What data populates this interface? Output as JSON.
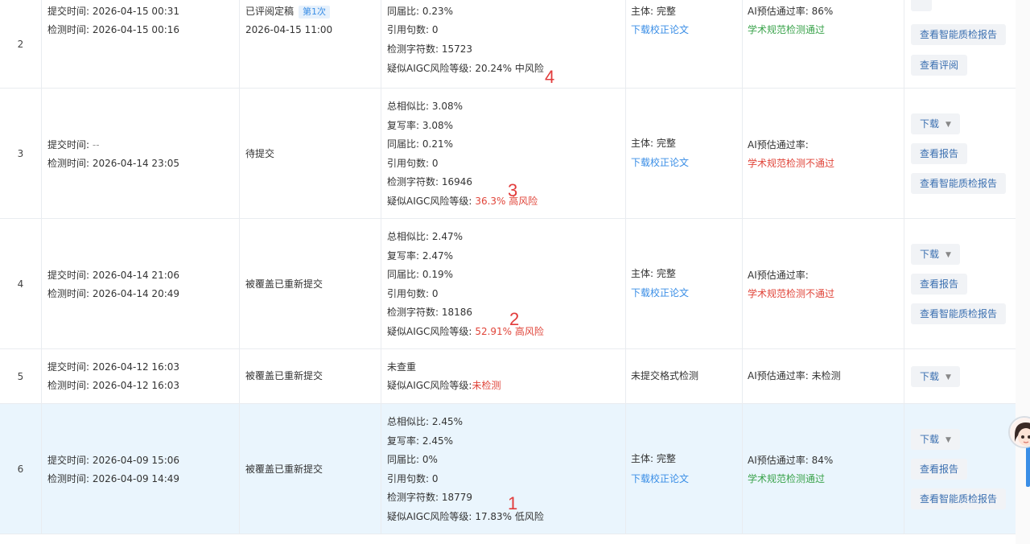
{
  "labels": {
    "submit_time": "提交时间:",
    "check_time": "检测时间:",
    "total_sim": "总相似比:",
    "rewrite_rate": "复写率:",
    "same_sim": "同届比:",
    "quote_count": "引用句数:",
    "char_count": "检测字符数:",
    "aigc_level": "疑似AIGC风险等级:",
    "subject": "主体:",
    "ai_pass": "AI预估通过率:"
  },
  "rows": [
    {
      "index": "2",
      "submit_time": "2026-04-15 00:31",
      "check_time": "2026-04-15 00:16",
      "status": "已评阅定稿",
      "status_badge": "第1次",
      "status_time": "2026-04-15 11:00",
      "same_sim": "0.23%",
      "quote_count": "0",
      "char_count": "15723",
      "aigc_value": "20.24% 中风险",
      "subject_value": "完整",
      "download_paper": "下载校正论文",
      "ai_pass_value": "86%",
      "ai_check_result": "学术规范检测通过",
      "buttons": [
        "查看智能质检报告",
        "查看评阅"
      ],
      "annotation": "4"
    },
    {
      "index": "3",
      "submit_time": "--",
      "check_time": "2026-04-14 23:05",
      "status": "待提交",
      "total_sim": "3.08%",
      "rewrite_rate": "3.08%",
      "same_sim": "0.21%",
      "quote_count": "0",
      "char_count": "16946",
      "aigc_value": "36.3% 高风险",
      "subject_value": "完整",
      "download_paper": "下载校正论文",
      "ai_pass_value": "",
      "ai_check_result": "学术规范检测不通过",
      "buttons": [
        "下载",
        "查看报告",
        "查看智能质检报告"
      ],
      "annotation": "3"
    },
    {
      "index": "4",
      "submit_time": "2026-04-14 21:06",
      "check_time": "2026-04-14 20:49",
      "status": "被覆盖已重新提交",
      "total_sim": "2.47%",
      "rewrite_rate": "2.47%",
      "same_sim": "0.19%",
      "quote_count": "0",
      "char_count": "18186",
      "aigc_value": "52.91% 高风险",
      "subject_value": "完整",
      "download_paper": "下载校正论文",
      "ai_pass_value": "",
      "ai_check_result": "学术规范检测不通过",
      "buttons": [
        "下载",
        "查看报告",
        "查看智能质检报告"
      ],
      "annotation": "2"
    },
    {
      "index": "5",
      "submit_time": "2026-04-12 16:03",
      "check_time": "2026-04-12 16:03",
      "status": "被覆盖已重新提交",
      "not_checked_text": "未查重",
      "aigc_value": "未检测",
      "format_status": "未提交格式检测",
      "ai_pass_value": "未检测",
      "buttons": [
        "下载"
      ]
    },
    {
      "index": "6",
      "submit_time": "2026-04-09 15:06",
      "check_time": "2026-04-09 14:49",
      "status": "被覆盖已重新提交",
      "total_sim": "2.45%",
      "rewrite_rate": "2.45%",
      "same_sim": "0%",
      "quote_count": "0",
      "char_count": "18779",
      "aigc_value": "17.83% 低风险",
      "subject_value": "完整",
      "download_paper": "下载校正论文",
      "ai_pass_value": "84%",
      "ai_check_result": "学术规范检测通过",
      "buttons": [
        "下载",
        "查看报告",
        "查看智能质检报告"
      ],
      "annotation": "1"
    }
  ],
  "icons": {
    "dropdown": "chevron-down-icon",
    "assistant": "assistant-avatar-icon"
  },
  "colors": {
    "high_risk": "#e0453a",
    "pass": "#3aa34b",
    "link": "#3a8ee6",
    "annotation": "#e23c3c",
    "row_highlight": "#eaf5fd"
  }
}
